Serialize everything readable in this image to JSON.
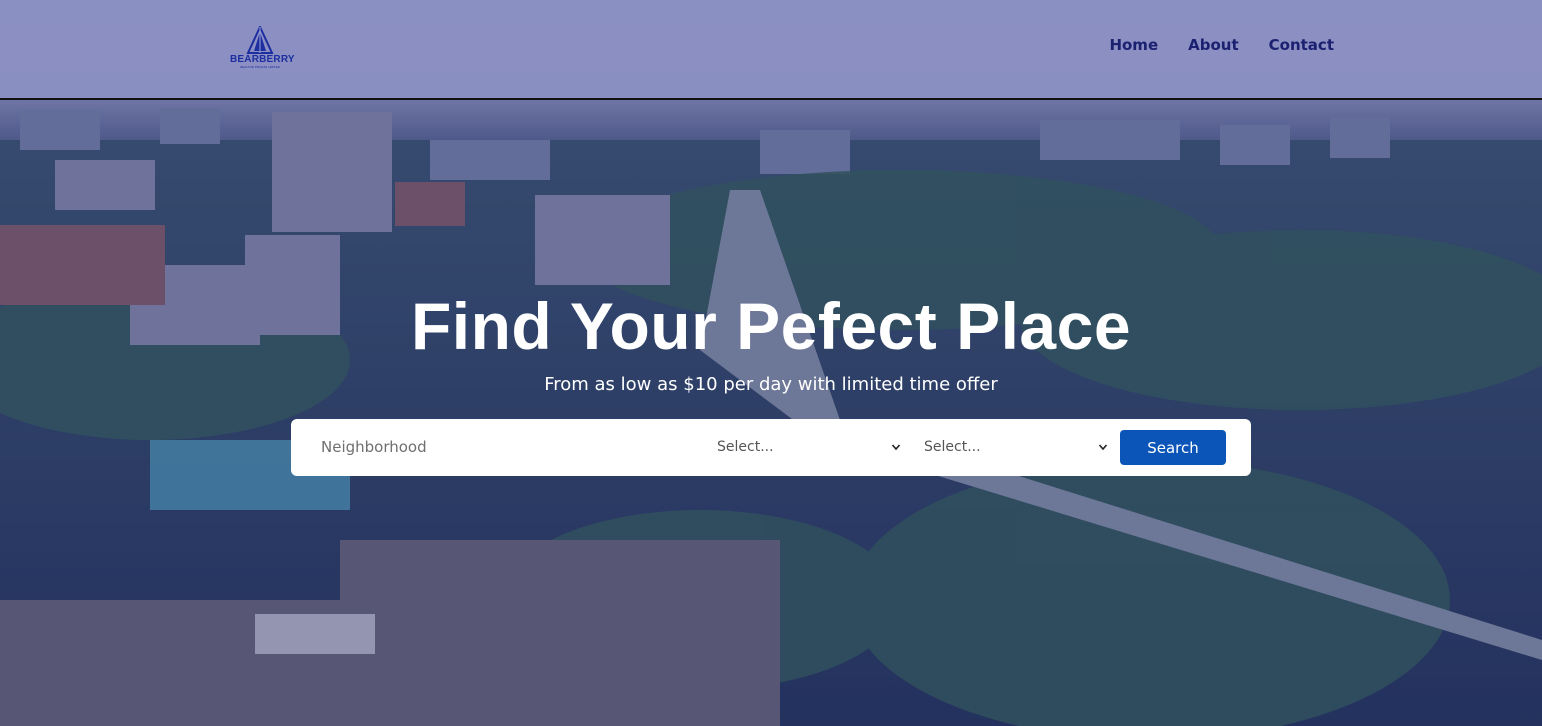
{
  "brand": {
    "name": "BEARBERRY",
    "tagline": "REALTOR PRIVATE LIMITED",
    "accent": "#1d2fa0"
  },
  "nav": {
    "items": [
      "Home",
      "About",
      "Contact"
    ],
    "color": "#1b2170"
  },
  "hero": {
    "title": "Find Your Pefect Place",
    "subtitle": "From as low as $10 per day with limited time offer"
  },
  "search": {
    "neighborhood_placeholder": "Neighborhood",
    "select_1": "Select...",
    "select_2": "Select...",
    "button_label": "Search",
    "button_color": "#0b55b8"
  },
  "icons": {
    "select_1_chevron": "chevron-down-icon",
    "select_2_chevron": "chevron-down-icon",
    "logo": "triangle-logo-icon"
  }
}
